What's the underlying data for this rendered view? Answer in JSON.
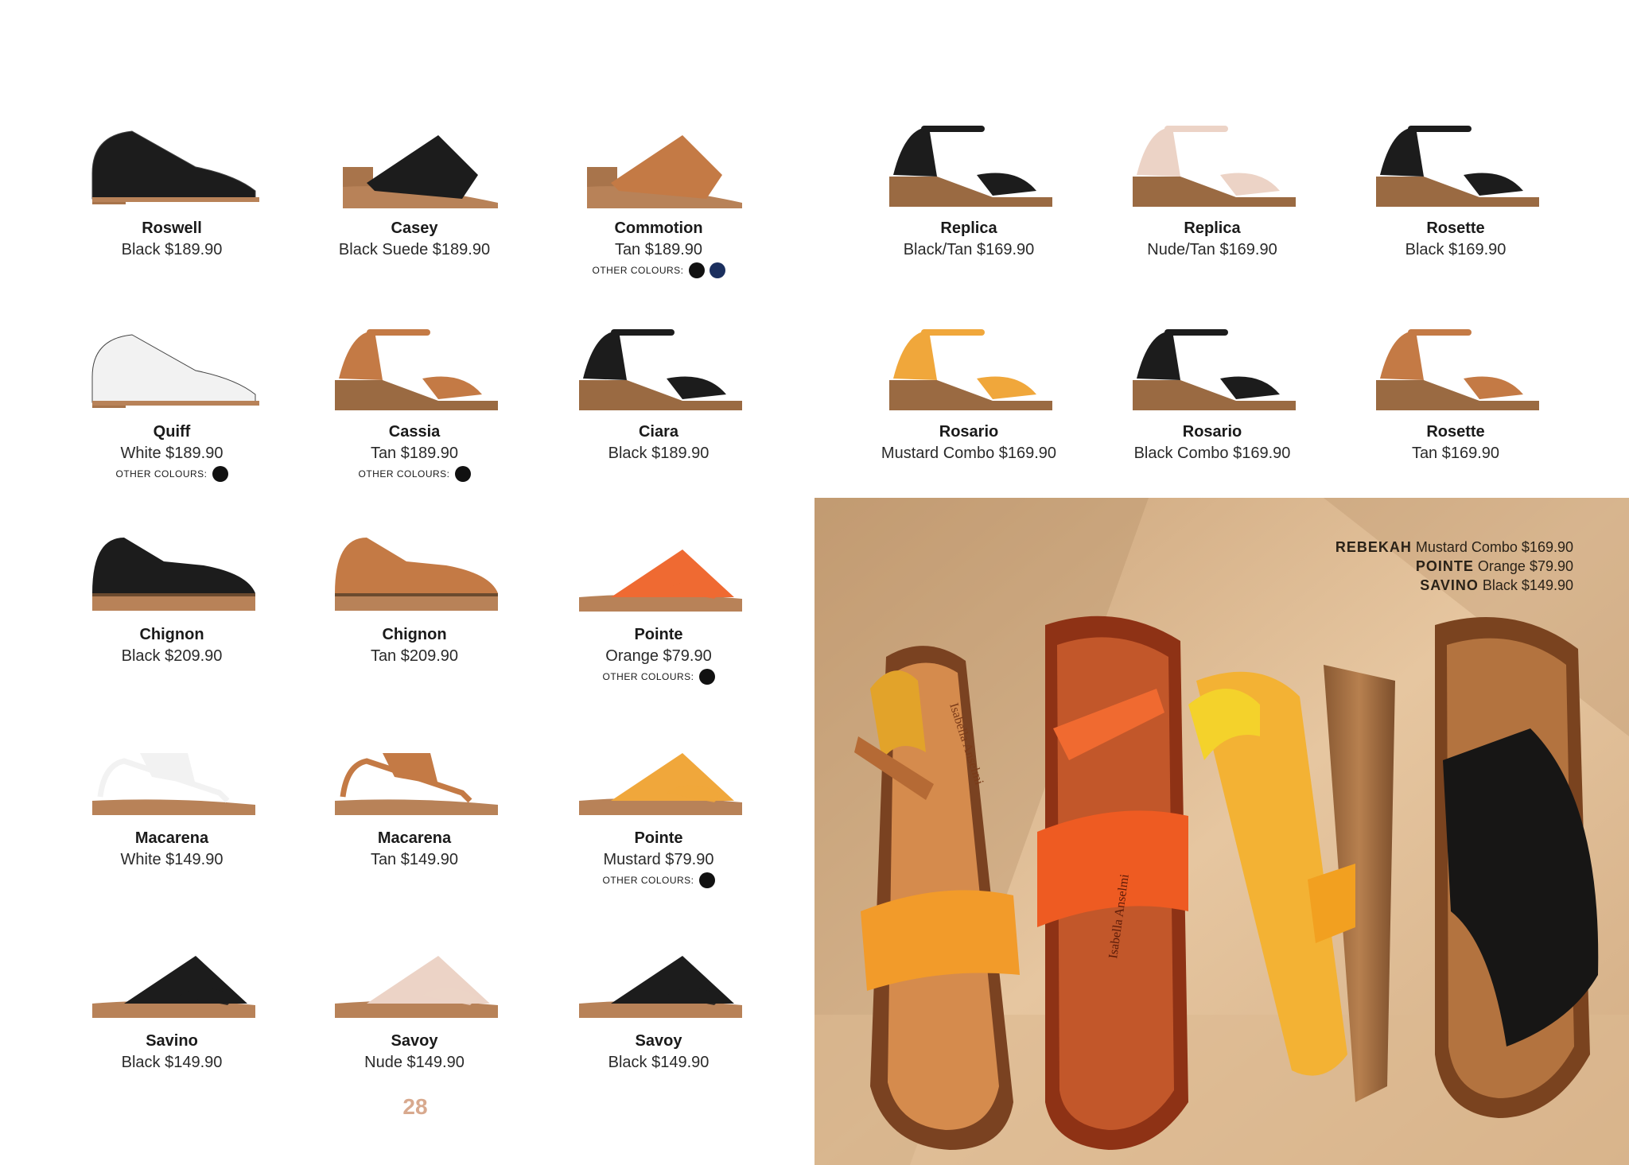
{
  "page_number": "28",
  "other_colours_label": "OTHER COLOURS:",
  "products": [
    {
      "name": "Roswell",
      "price": "Black $189.90",
      "shoe": "black",
      "style": "heel"
    },
    {
      "name": "Casey",
      "price": "Black Suede $189.90",
      "shoe": "black",
      "style": "mule"
    },
    {
      "name": "Commotion",
      "price": "Tan $189.90",
      "shoe": "tan",
      "style": "mule",
      "others": [
        "#111111",
        "#1b2f5e"
      ]
    },
    {
      "name": "Quiff",
      "price": "White $189.90",
      "shoe": "white",
      "style": "heel",
      "others": [
        "#111111"
      ]
    },
    {
      "name": "Cassia",
      "price": "Tan $189.90",
      "shoe": "tan",
      "style": "wedge",
      "others": [
        "#111111"
      ]
    },
    {
      "name": "Ciara",
      "price": "Black $189.90",
      "shoe": "black",
      "style": "wedge"
    },
    {
      "name": "Chignon",
      "price": "Black $209.90",
      "shoe": "black",
      "style": "platform"
    },
    {
      "name": "Chignon",
      "price": "Tan $209.90",
      "shoe": "tan",
      "style": "platform"
    },
    {
      "name": "Pointe",
      "price": "Orange $79.90",
      "shoe": "orange",
      "style": "slide",
      "others": [
        "#111111"
      ]
    },
    {
      "name": "Macarena",
      "price": "White $149.90",
      "shoe": "white",
      "style": "thong"
    },
    {
      "name": "Macarena",
      "price": "Tan $149.90",
      "shoe": "tan",
      "style": "thong"
    },
    {
      "name": "Pointe",
      "price": "Mustard $79.90",
      "shoe": "mustard",
      "style": "slide",
      "others": [
        "#111111"
      ]
    },
    {
      "name": "Savino",
      "price": "Black $149.90",
      "shoe": "black",
      "style": "slide"
    },
    {
      "name": "Savoy",
      "price": "Nude $149.90",
      "shoe": "nude",
      "style": "slide"
    },
    {
      "name": "Savoy",
      "price": "Black $149.90",
      "shoe": "black",
      "style": "slide"
    },
    {
      "name": "Replica",
      "price": "Black/Tan $169.90",
      "shoe": "black",
      "style": "wedge"
    },
    {
      "name": "Replica",
      "price": "Nude/Tan $169.90",
      "shoe": "nude",
      "style": "wedge"
    },
    {
      "name": "Rosette",
      "price": "Black $169.90",
      "shoe": "black",
      "style": "wedge"
    },
    {
      "name": "Rosario",
      "price": "Mustard Combo $169.90",
      "shoe": "mustard",
      "style": "wedge"
    },
    {
      "name": "Rosario",
      "price": "Black Combo $169.90",
      "shoe": "black",
      "style": "wedge"
    },
    {
      "name": "Rosette",
      "price": "Tan $169.90",
      "shoe": "tan",
      "style": "wedge"
    }
  ],
  "hero": {
    "caption": [
      {
        "name": "REBEKAH",
        "detail": "Mustard Combo $169.90"
      },
      {
        "name": "POINTE",
        "detail": "Orange $79.90"
      },
      {
        "name": "SAVINO",
        "detail": "Black $149.90"
      }
    ],
    "brand_stamp": "Isabella Anselmi"
  },
  "colors": {
    "black": "#1c1c1c",
    "tan": "#c47a45",
    "white": "#f2f2f2",
    "orange": "#ef6a32",
    "mustard": "#f0a73b",
    "nude": "#ecd3c6",
    "sole": "#b88258",
    "background_sand": "#e3c29a",
    "page_number": "#d8a98e"
  }
}
